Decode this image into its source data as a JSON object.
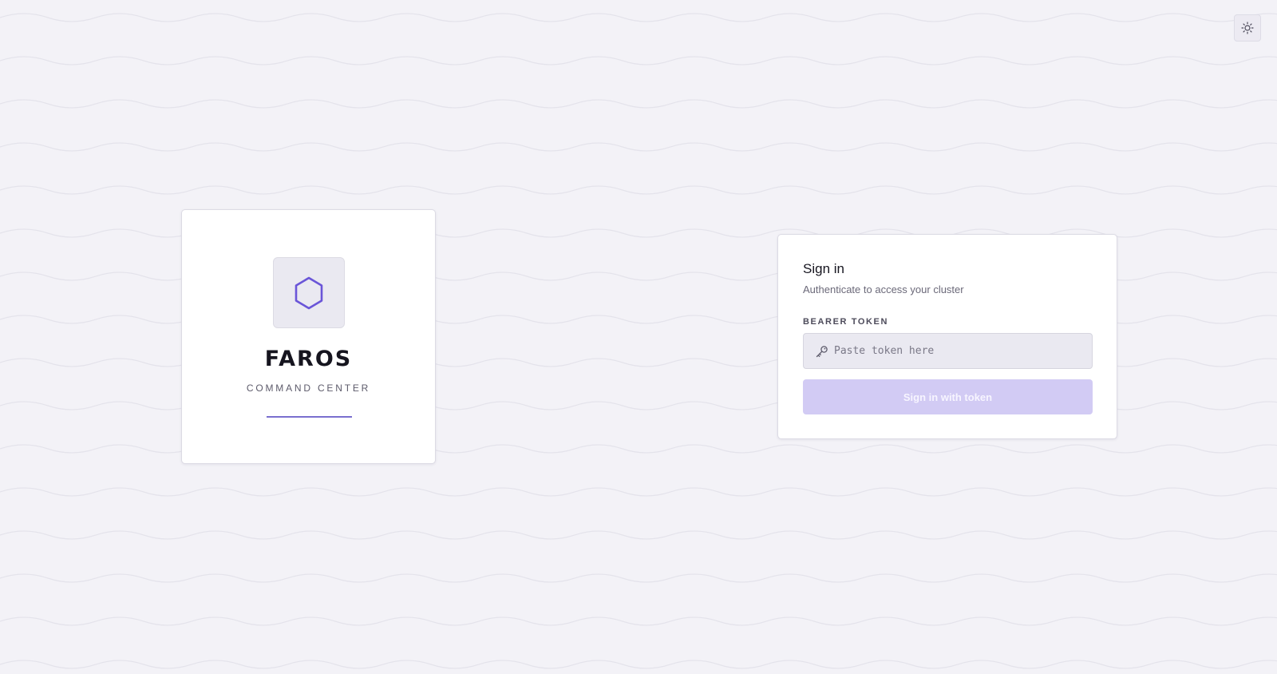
{
  "header": {
    "theme_toggle_icon": "sun-icon"
  },
  "brand": {
    "logo_icon": "hexagon-icon",
    "name": "FAROS",
    "subtitle": "COMMAND CENTER",
    "accent_color": "#6a55d8"
  },
  "signin": {
    "title": "Sign in",
    "subtitle": "Authenticate to access your cluster",
    "token_label": "BEARER TOKEN",
    "token_icon": "key-icon",
    "token_value": "",
    "token_placeholder": "Paste token here",
    "button_label": "Sign in with token",
    "button_color": "#d2cbf4"
  }
}
